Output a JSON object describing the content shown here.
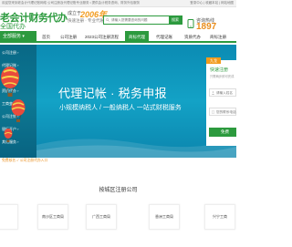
{
  "topbar": {
    "notice": "欢迎您来到老会计代理记账网络 公司注册及代理记账专业服务 • 提供会计税务咨询、财务外包服务",
    "links": "登录中心 | 收藏本站 | 网站地图"
  },
  "header": {
    "logo_main": "老会计财务代办",
    "logo_sub": "全国代办",
    "slogan_top": "成立于",
    "slogan_year": "2006年",
    "slogan_bottom": "快速注册 · 专业代账 · 贴心服务",
    "search_placeholder": "请输入您需要咨询的问题",
    "search_button": "搜索",
    "hotline_label": "咨询热线",
    "hotline_number": "1897"
  },
  "nav": {
    "all_services": "全部服务 ▾",
    "items": [
      "首页",
      "公司注册",
      "2023公司注册流程",
      "商标代理",
      "代理记账",
      "资质代办",
      "商标注册"
    ],
    "active_index": 3
  },
  "hero": {
    "sidebar_rows": [
      "公司注册 ›",
      "代理记账 ›",
      "商标代理 ›",
      "资质代办 ›",
      "工商变更 ›",
      "公司注销 ›",
      "银行开户 ›",
      "其他服务 ›"
    ],
    "headline": "代理记帐 · 税务申报",
    "subhead": "小规模纳税人 / 一般纳税人 一站式财税服务"
  },
  "form": {
    "tag": "九龙",
    "title": "快速注册",
    "subtitle": "只需两步即可完成",
    "name_placeholder": "请输入姓名",
    "phone_placeholder": "您的联系电话",
    "submit": "免费"
  },
  "ticker": {
    "text": "免费核名 ✓ 公司注册代办入口"
  },
  "section": {
    "title": "按城区注册公司"
  },
  "districts": [
    "",
    "南沙区工商局",
    "广西工商局",
    "香洲工商局",
    "兴宁工商"
  ],
  "colors": {
    "brand_green": "#2c9a3e",
    "accent_orange": "#f29b1d",
    "hero_blue": "#0b8bb3"
  }
}
